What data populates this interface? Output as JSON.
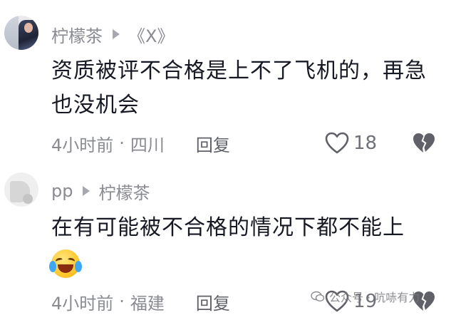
{
  "comments": [
    {
      "username": "柠檬茶",
      "reply_to": "《X》",
      "text": "资质被评不合格是上不了飞机的，再急也没机会",
      "time": "4小时前",
      "location": "四川",
      "reply_label": "回复",
      "likes": "18"
    },
    {
      "username": "pp",
      "reply_to": "柠檬茶",
      "text": "在有可能被不合格的情况下都不能上",
      "time": "4小时前",
      "location": "福建",
      "reply_label": "回复",
      "likes": "19"
    }
  ],
  "separator": "·",
  "watermark": {
    "text": "公众号 · 吭哧有力"
  },
  "icons": {
    "reply_arrow": "play-triangle-icon",
    "like": "heart-outline-icon",
    "dislike": "broken-heart-icon",
    "emoji": "laughing-crying-emoji-icon",
    "watermark": "wechat-icon"
  },
  "colors": {
    "text": "#161823",
    "secondary": "#8a8b91",
    "icon": "#5f6068"
  }
}
